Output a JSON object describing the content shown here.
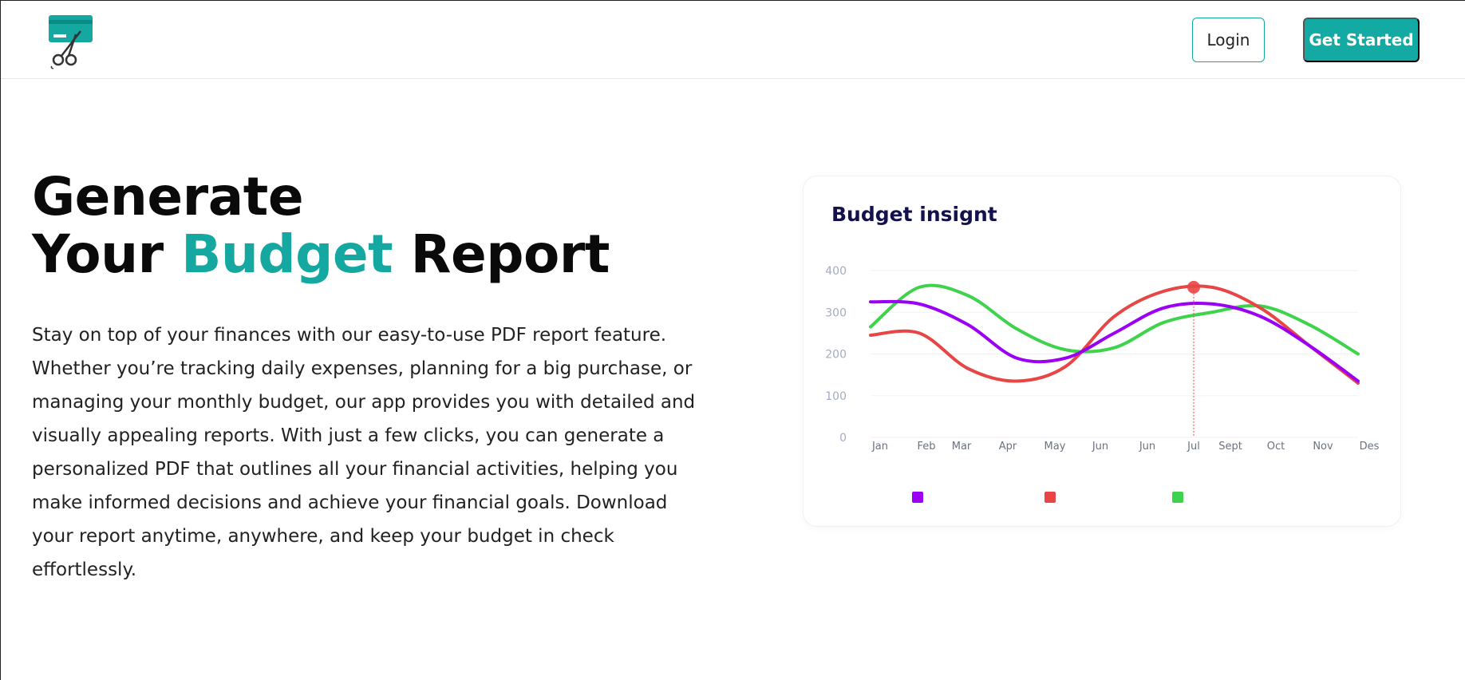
{
  "header": {
    "logo_icon": "scissors-card-logo-icon",
    "login_label": "Login",
    "get_started_label": "Get Started"
  },
  "hero": {
    "title_line1": "Generate",
    "title_line2_pre": "Your ",
    "title_line2_accent": "Budget",
    "title_line2_post": " Report",
    "description": "Stay on top of your finances with our easy-to-use PDF report feature. Whether you’re tracking daily expenses, planning for a big purchase, or managing your monthly budget, our app provides you with detailed and visually appealing reports. With just a few clicks, you can generate a personalized PDF that outlines all your financial activities, helping you make informed decisions and achieve your financial goals. Download your report anytime, anywhere, and keep your budget in check effortlessly."
  },
  "colors": {
    "accent": "#14a8a0",
    "purple": "#9b00f5",
    "red": "#e84545",
    "green": "#3fd24d"
  },
  "chart_data": {
    "type": "line",
    "title": "Budget insignt",
    "categories": [
      "Jan",
      "Feb",
      "Mar",
      "Apr",
      "May",
      "Jun",
      "Jun",
      "Jul",
      "Sept",
      "Oct",
      "Nov",
      "Des"
    ],
    "ylim": [
      0,
      400
    ],
    "yticks": [
      0,
      100,
      200,
      300,
      400
    ],
    "grid": true,
    "highlight": {
      "category_index": 7,
      "series": "red",
      "value": 360
    },
    "series": [
      {
        "color": "#9b00f5",
        "values": [
          325,
          320,
          270,
          190,
          190,
          250,
          310,
          320,
          290,
          220,
          135
        ]
      },
      {
        "color": "#e84545",
        "values": [
          245,
          250,
          165,
          135,
          170,
          290,
          350,
          360,
          310,
          220,
          130
        ]
      },
      {
        "color": "#3fd24d",
        "values": [
          265,
          360,
          340,
          260,
          210,
          215,
          275,
          300,
          315,
          270,
          200
        ]
      }
    ],
    "legend_colors": [
      "#9b00f5",
      "#e84545",
      "#3fd24d"
    ]
  }
}
